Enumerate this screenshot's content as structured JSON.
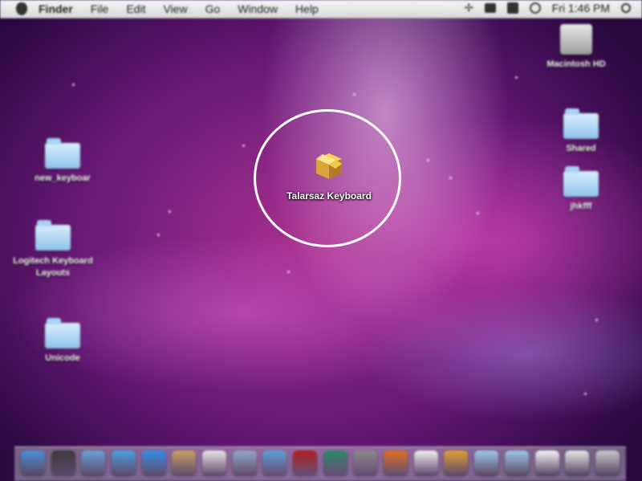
{
  "menubar": {
    "items": [
      "Finder",
      "File",
      "Edit",
      "View",
      "Go",
      "Window",
      "Help"
    ],
    "clock": "Fri 1:46 PM"
  },
  "desktop_icons": {
    "macintosh_hd": "Macintosh HD",
    "shared": "Shared",
    "jhkfff": "jhkfff",
    "new_keyboard": "new_keyboar",
    "logitech": "Logitech Keyboard Layouts",
    "unicode": "Unicode"
  },
  "highlight": {
    "package_label": "Talarsaz Keyboard",
    "circle_color": "#ffffff"
  },
  "dock": {
    "items": [
      {
        "icon": "finder-icon",
        "color": "#4c8fd6"
      },
      {
        "icon": "dashboard-icon",
        "color": "#3a3a3a"
      },
      {
        "icon": "mail-icon",
        "color": "#6aa2d8"
      },
      {
        "icon": "safari-icon",
        "color": "#4aa0e0"
      },
      {
        "icon": "ichat-icon",
        "color": "#2f8fe8"
      },
      {
        "icon": "address-book-icon",
        "color": "#c8a060"
      },
      {
        "icon": "ical-icon",
        "color": "#e8e8e8"
      },
      {
        "icon": "preview-icon",
        "color": "#8aa8c8"
      },
      {
        "icon": "itunes-icon",
        "color": "#5aa0d8"
      },
      {
        "icon": "photo-booth-icon",
        "color": "#b02020"
      },
      {
        "icon": "time-machine-icon",
        "color": "#2a8a6a"
      },
      {
        "icon": "system-preferences-icon",
        "color": "#8a8a8a"
      },
      {
        "icon": "firefox-icon",
        "color": "#e07020"
      },
      {
        "icon": "textedit-icon",
        "color": "#f0f0f0"
      },
      {
        "icon": "package-icon",
        "color": "#e0a030"
      },
      {
        "icon": "applications-folder-icon",
        "color": "#9cc8ea"
      },
      {
        "icon": "documents-folder-icon",
        "color": "#9cc8ea"
      },
      {
        "icon": "document-icon",
        "color": "#f4f4f4"
      },
      {
        "icon": "mail-stack-icon",
        "color": "#e8e8e8"
      },
      {
        "icon": "trash-icon",
        "color": "#c8c8c8"
      }
    ]
  }
}
